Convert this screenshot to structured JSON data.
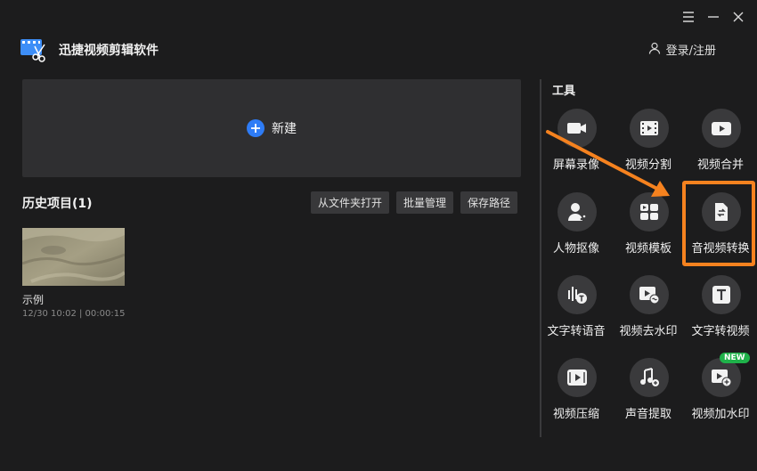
{
  "app": {
    "title": "迅捷视频剪辑软件",
    "login_label": "登录/注册"
  },
  "window_controls": {
    "menu_icon": "menu-icon",
    "minimize_icon": "minimize-icon",
    "close_icon": "close-icon"
  },
  "main": {
    "new_label": "新建"
  },
  "history": {
    "title": "历史项目(1)",
    "actions": [
      "从文件夹打开",
      "批量管理",
      "保存路径"
    ],
    "items": [
      {
        "name": "示例",
        "meta": "12/30 10:02 | 00:00:15"
      }
    ]
  },
  "tools": {
    "title": "工具",
    "items": [
      {
        "label": "屏幕录像",
        "icon": "camera-icon"
      },
      {
        "label": "视频分割",
        "icon": "film-icon"
      },
      {
        "label": "视频合并",
        "icon": "play-icon"
      },
      {
        "label": "人物抠像",
        "icon": "person-icon"
      },
      {
        "label": "视频模板",
        "icon": "template-icon"
      },
      {
        "label": "音视频转换",
        "icon": "convert-icon"
      },
      {
        "label": "文字转语音",
        "icon": "text-to-speech-icon"
      },
      {
        "label": "视频去水印",
        "icon": "remove-watermark-icon"
      },
      {
        "label": "文字转视频",
        "icon": "text-icon"
      },
      {
        "label": "视频压缩",
        "icon": "compress-icon"
      },
      {
        "label": "声音提取",
        "icon": "music-icon"
      },
      {
        "label": "视频加水印",
        "icon": "add-watermark-icon"
      }
    ],
    "new_badge": "NEW"
  },
  "colors": {
    "background": "#1c1c1d",
    "accent": "#2e7cf6",
    "highlight": "#f5821f",
    "badge": "#1fb24a"
  }
}
